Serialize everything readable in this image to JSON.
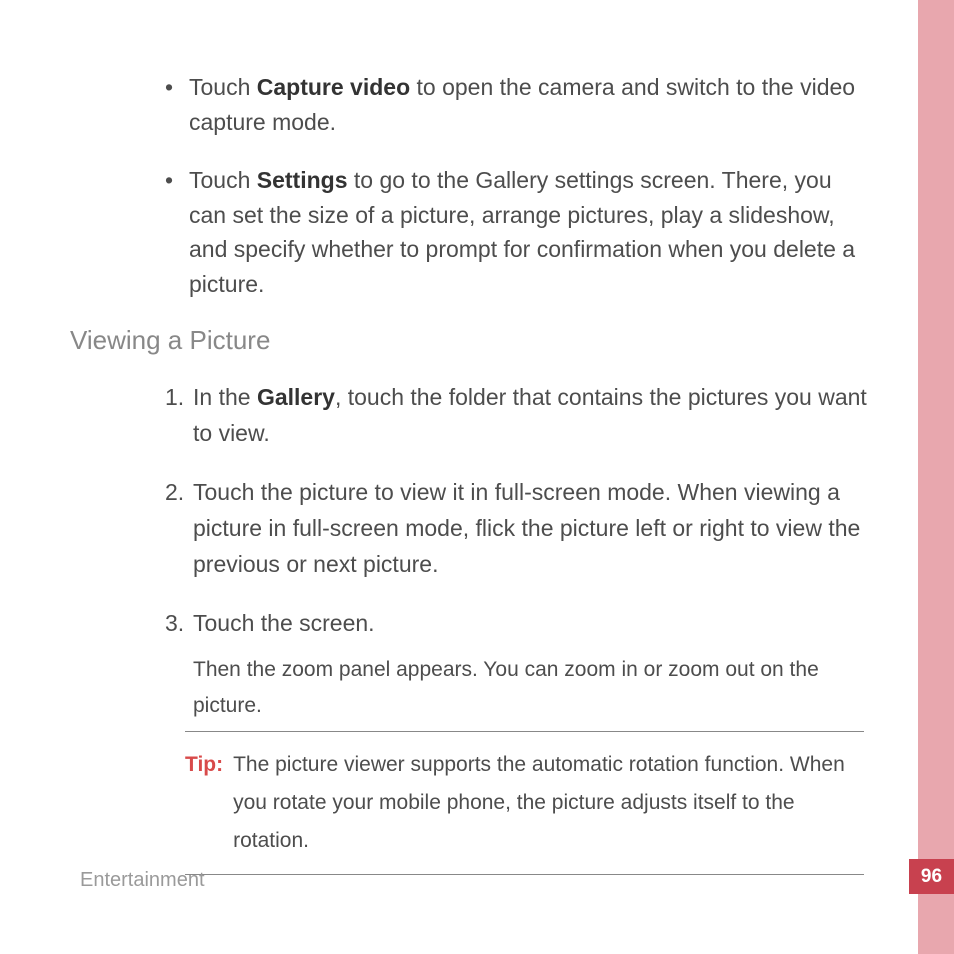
{
  "bullets": [
    {
      "pre": "Touch ",
      "bold": "Capture video",
      "post": " to open the camera and switch to the video capture mode."
    },
    {
      "pre": "Touch ",
      "bold": "Settings",
      "post": " to go to the Gallery settings screen. There, you can set the size of a picture, arrange pictures, play a slideshow, and specify whether to prompt for confirmation when you delete a picture."
    }
  ],
  "section_heading": "Viewing a Picture",
  "steps": [
    {
      "num": "1.",
      "pre": "In the ",
      "bold": "Gallery",
      "post": ", touch the folder that contains the pictures you want to view."
    },
    {
      "num": "2.",
      "full": "Touch the picture to view it in full-screen mode. When viewing a picture in full-screen mode, flick the picture left or right to view the previous or next picture."
    },
    {
      "num": "3.",
      "full": "Touch the screen.",
      "sub": "Then the zoom panel appears. You can zoom in or zoom out on the picture."
    }
  ],
  "tip": {
    "label": "Tip:",
    "text": "The picture viewer supports the automatic rotation function. When you rotate your mobile phone, the picture adjusts itself to the rotation."
  },
  "footer": "Entertainment",
  "page_number": "96"
}
